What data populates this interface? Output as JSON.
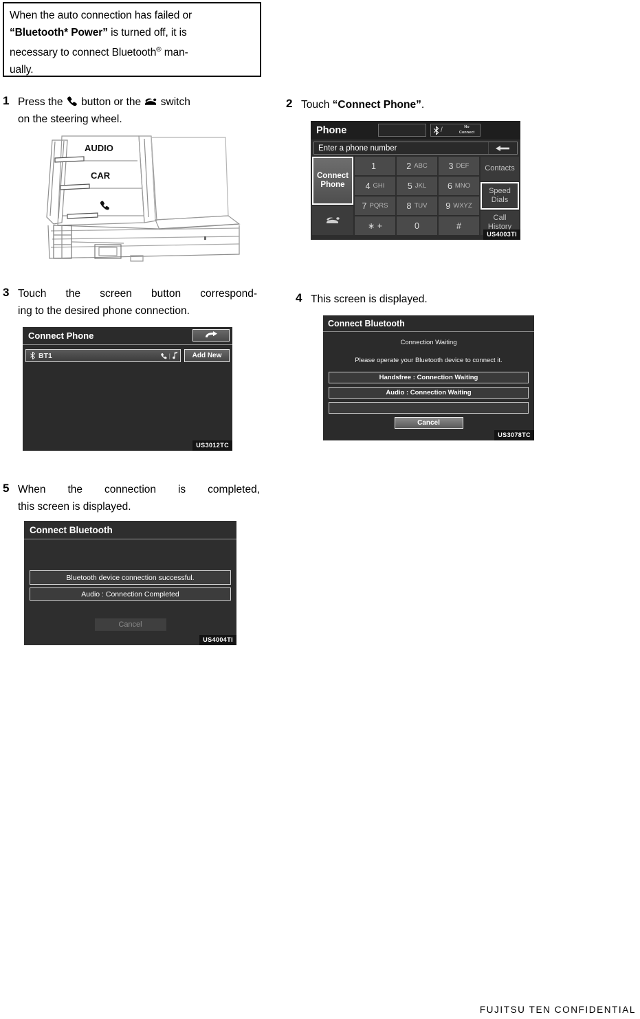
{
  "note": {
    "line1": "When the auto connection has failed or",
    "line2_bold": "“Bluetooth* Power”",
    "line2_rest": " is turned off, it is",
    "line3_a": "necessary to connect Bluetooth",
    "line3_sup": "®",
    "line3_b": " man-",
    "line4": "ually."
  },
  "steps": {
    "s1": {
      "num": "1",
      "text_a": "Press the",
      "icon_a": "phone-handset-icon",
      "text_b": "button or the",
      "icon_b": "telephone-icon",
      "text_c": "switch",
      "line2": "on the steering wheel."
    },
    "s2": {
      "num": "2",
      "text_a": "Touch ",
      "text_bold": "“Connect Phone”",
      "text_b": "."
    },
    "s3": {
      "num": "3",
      "line1": "Touch the screen button correspond-",
      "line2": "ing to the desired phone connection."
    },
    "s4": {
      "num": "4",
      "line1": "This screen is displayed."
    },
    "s5": {
      "num": "5",
      "line1": "When the connection is completed,",
      "line2": "this screen is displayed."
    }
  },
  "steering": {
    "label_audio": "AUDIO",
    "label_car": "CAR",
    "icon_phone": "phone-handset-icon"
  },
  "phone_screen": {
    "code": "US4003TI",
    "title": "Phone",
    "status": {
      "bt_icon": "bluetooth-icon",
      "separator": "/",
      "signal_line1": "No",
      "signal_line2": "Connect"
    },
    "entry_placeholder": "Enter a phone number",
    "backspace_icon": "backspace-arrow-icon",
    "connect_phone_label_line1": "Connect",
    "connect_phone_label_line2": "Phone",
    "hangup_icon": "hangup-telephone-icon",
    "keys": [
      {
        "digit": "1",
        "letters": ""
      },
      {
        "digit": "2",
        "letters": "ABC"
      },
      {
        "digit": "3",
        "letters": "DEF"
      },
      {
        "digit": "4",
        "letters": "GHI"
      },
      {
        "digit": "5",
        "letters": "JKL"
      },
      {
        "digit": "6",
        "letters": "MNO"
      },
      {
        "digit": "7",
        "letters": "PQRS"
      },
      {
        "digit": "8",
        "letters": "TUV"
      },
      {
        "digit": "9",
        "letters": "WXYZ"
      },
      {
        "digit": "∗ +",
        "letters": ""
      },
      {
        "digit": "0",
        "letters": ""
      },
      {
        "digit": "#",
        "letters": ""
      }
    ],
    "side_buttons": [
      {
        "label": "Contacts",
        "highlighted": false
      },
      {
        "label": "Speed\nDials",
        "line1": "Speed",
        "line2": "Dials",
        "highlighted": true
      },
      {
        "label": "Call\nHistory",
        "line1": "Call",
        "line2": "History",
        "highlighted": false
      }
    ]
  },
  "connect_phone_screen": {
    "code": "US3012TC",
    "title": "Connect Phone",
    "back_icon": "return-arrow-icon",
    "device_name": "BT1",
    "device_bt_icon": "bluetooth-icon",
    "device_phone_icon": "phone-handset-icon",
    "device_audio_icon": "music-note-icon",
    "add_new_label": "Add New"
  },
  "waiting_screen": {
    "code": "US3078TC",
    "title": "Connect Bluetooth",
    "heading": "Connection Waiting",
    "message": "Please operate your Bluetooth device to connect it.",
    "rows": [
      "Handsfree : Connection Waiting",
      "Audio : Connection Waiting",
      ""
    ],
    "cancel_label": "Cancel"
  },
  "success_screen": {
    "code": "US4004TI",
    "title": "Connect Bluetooth",
    "rows": [
      "Bluetooth device connection successful.",
      "Audio : Connection Completed"
    ],
    "cancel_label": "Cancel"
  },
  "footer": {
    "text": "FUJITSU  TEN  CONFIDENTIAL"
  }
}
